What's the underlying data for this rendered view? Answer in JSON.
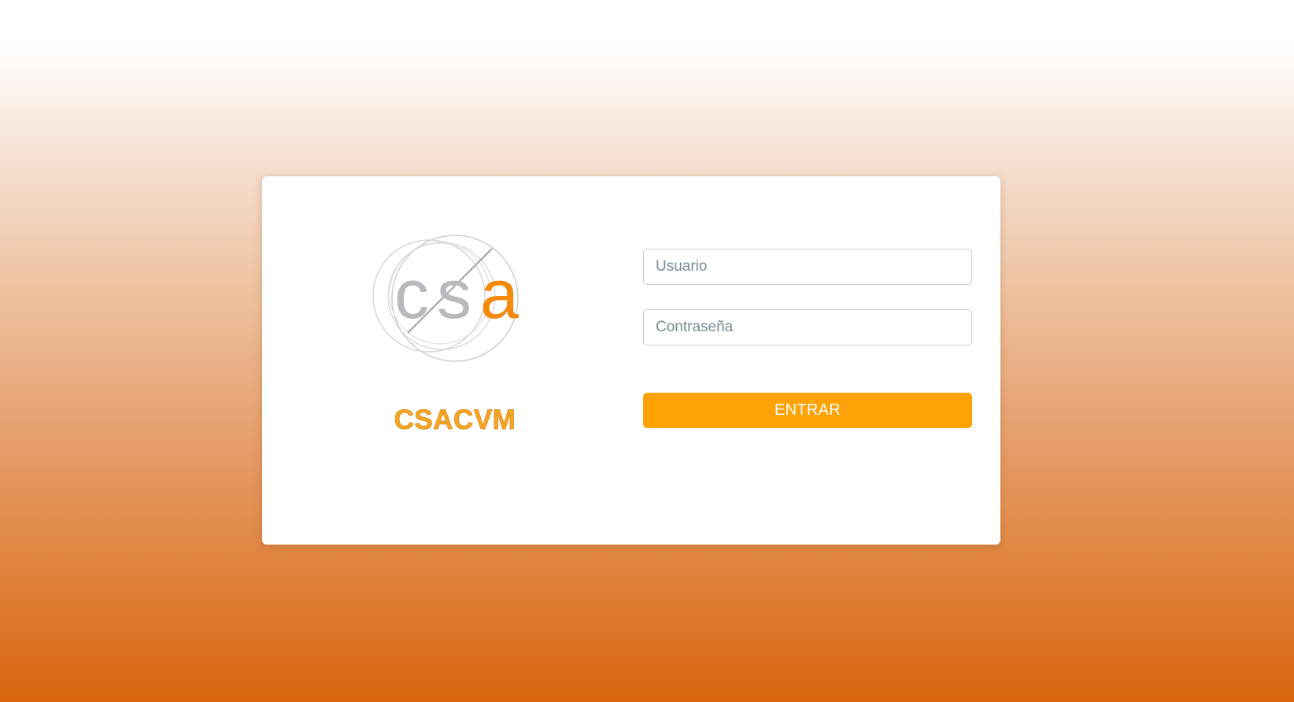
{
  "login": {
    "logo_text": "csa",
    "brand_name": "CSACVM",
    "username_placeholder": "Usuario",
    "password_placeholder": "Contraseña",
    "submit_label": "ENTRAR"
  },
  "colors": {
    "accent": "#ffa206",
    "brand_text": "#f5a623",
    "logo_orange": "#f5890a",
    "logo_gray": "#b8b8bd",
    "gradient_bottom": "#d9640f"
  }
}
